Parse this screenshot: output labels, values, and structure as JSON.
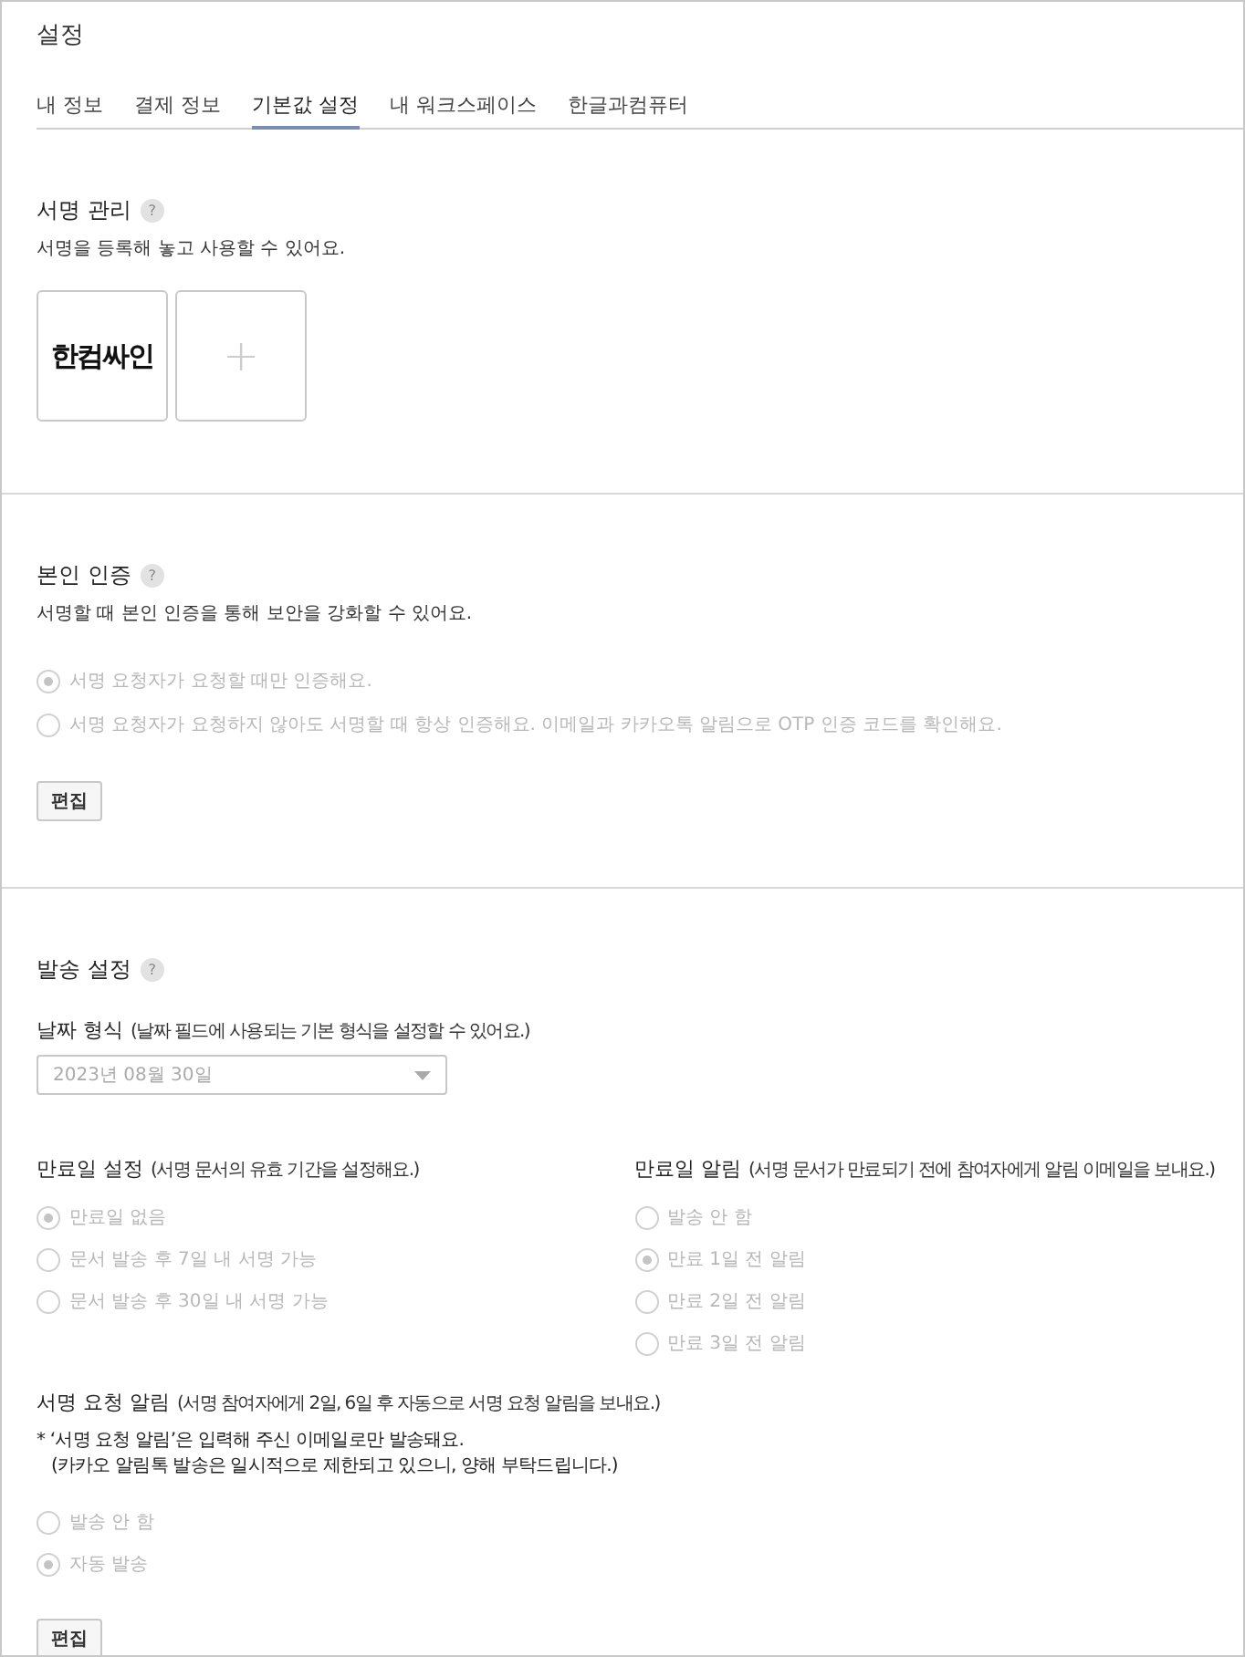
{
  "page": {
    "title": "설정"
  },
  "tabs": [
    {
      "label": "내 정보",
      "selected": false
    },
    {
      "label": "결제 정보",
      "selected": false
    },
    {
      "label": "기본값 설정",
      "selected": true
    },
    {
      "label": "내 워크스페이스",
      "selected": false
    },
    {
      "label": "한글과컴퓨터",
      "selected": false
    }
  ],
  "signature_section": {
    "title": "서명 관리",
    "help": "?",
    "description": "서명을 등록해 놓고 사용할 수 있어요.",
    "signatures": [
      "한컴싸인"
    ],
    "add_button": "+"
  },
  "verification_section": {
    "title": "본인 인증",
    "help": "?",
    "description": "서명할 때 본인 인증을 통해 보안을 강화할 수 있어요.",
    "disabled": true,
    "options": [
      {
        "label": "서명 요청자가 요청할 때만 인증해요.",
        "selected": true
      },
      {
        "label": "서명 요청자가 요청하지 않아도 서명할 때 항상 인증해요. 이메일과 카카오톡 알림으로 OTP 인증 코드를 확인해요.",
        "selected": false
      }
    ],
    "edit_button": "편집"
  },
  "sending_section": {
    "title": "발송 설정",
    "help": "?",
    "date_format": {
      "label": "날짜 형식",
      "hint": "(날짜 필드에 사용되는 기본 형식을 설정할 수 있어요.)",
      "value": "2023년 08월 30일",
      "disabled": true
    },
    "expiry": {
      "label": "만료일 설정",
      "hint": "(서명 문서의 유효 기간을 설정해요.)",
      "disabled": true,
      "options": [
        {
          "label": "만료일 없음",
          "selected": true
        },
        {
          "label": "문서 발송 후 7일 내 서명 가능",
          "selected": false
        },
        {
          "label": "문서 발송 후 30일 내 서명 가능",
          "selected": false
        }
      ]
    },
    "expiry_alert": {
      "label": "만료일 알림",
      "hint": "(서명 문서가 만료되기 전에 참여자에게 알림 이메일을 보내요.)",
      "disabled": true,
      "options": [
        {
          "label": "발송 안 함",
          "selected": false
        },
        {
          "label": "만료 1일 전 알림",
          "selected": true
        },
        {
          "label": "만료 2일 전 알림",
          "selected": false
        },
        {
          "label": "만료 3일 전 알림",
          "selected": false
        }
      ]
    },
    "request_alert": {
      "label": "서명 요청 알림",
      "hint": "(서명 참여자에게 2일, 6일 후 자동으로 서명 요청 알림을 보내요.)",
      "notes": [
        "* ‘서명 요청 알림’은 입력해 주신 이메일로만 발송돼요.",
        "(카카오 알림톡 발송은 일시적으로 제한되고 있으니, 양해 부탁드립니다.)"
      ],
      "disabled": true,
      "options": [
        {
          "label": "발송 안 함",
          "selected": false
        },
        {
          "label": "자동 발송",
          "selected": true
        }
      ]
    },
    "edit_button": "편집"
  }
}
